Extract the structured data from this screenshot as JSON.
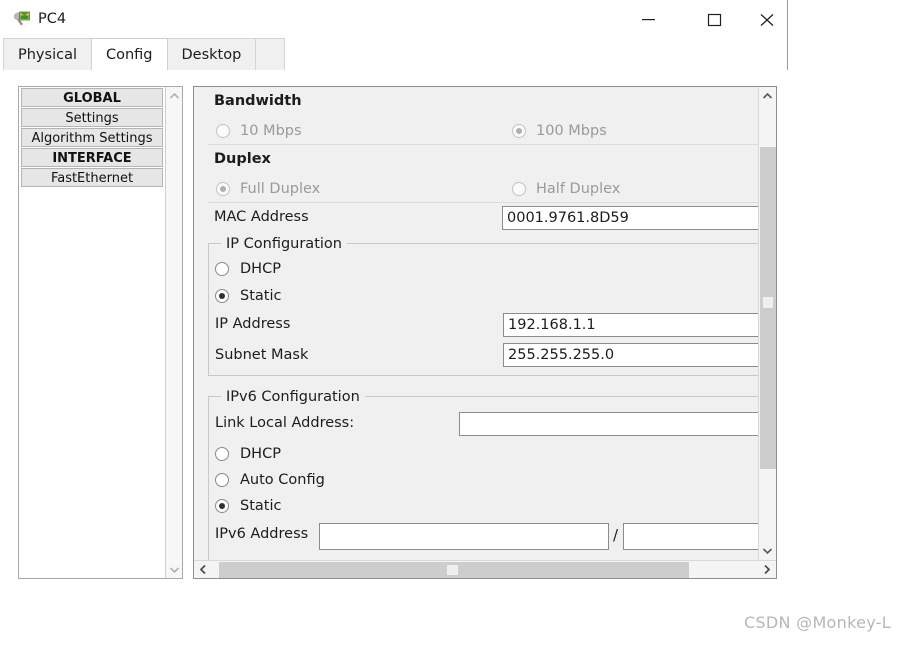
{
  "window": {
    "title": "PC4",
    "icon": "pc-device-icon",
    "controls": {
      "minimize": "minimize-icon",
      "maximize": "maximize-icon",
      "close": "close-icon"
    }
  },
  "tabs": [
    {
      "label": "Physical",
      "active": false
    },
    {
      "label": "Config",
      "active": true
    },
    {
      "label": "Desktop",
      "active": false
    }
  ],
  "sidebar": {
    "items": [
      {
        "label": "GLOBAL",
        "type": "header"
      },
      {
        "label": "Settings",
        "type": "item"
      },
      {
        "label": "Algorithm Settings",
        "type": "item"
      },
      {
        "label": "INTERFACE",
        "type": "header"
      },
      {
        "label": "FastEthernet",
        "type": "item"
      }
    ]
  },
  "config": {
    "bandwidth": {
      "label": "Bandwidth",
      "auto_checked": true,
      "options": [
        {
          "label": "10 Mbps",
          "selected": false,
          "disabled": true
        },
        {
          "label": "100 Mbps",
          "selected": true,
          "disabled": true
        }
      ]
    },
    "duplex": {
      "label": "Duplex",
      "auto_checked": true,
      "options": [
        {
          "label": "Full Duplex",
          "selected": true,
          "disabled": true
        },
        {
          "label": "Half Duplex",
          "selected": false,
          "disabled": true
        }
      ]
    },
    "mac": {
      "label": "MAC Address",
      "value": "0001.9761.8D59"
    },
    "ip_configuration": {
      "title": "IP Configuration",
      "dhcp": {
        "label": "DHCP",
        "selected": false
      },
      "static": {
        "label": "Static",
        "selected": true
      },
      "ip_address": {
        "label": "IP Address",
        "value": "192.168.1.1"
      },
      "subnet_mask": {
        "label": "Subnet Mask",
        "value": "255.255.255.0"
      }
    },
    "ipv6_configuration": {
      "title": "IPv6 Configuration",
      "link_local": {
        "label": "Link Local Address:",
        "value": ""
      },
      "dhcp": {
        "label": "DHCP",
        "selected": false
      },
      "auto_config": {
        "label": "Auto Config",
        "selected": false
      },
      "static": {
        "label": "Static",
        "selected": true
      },
      "ipv6_address": {
        "label": "IPv6 Address",
        "value": "",
        "separator": "/",
        "prefix_value": ""
      }
    }
  },
  "watermark": "CSDN @Monkey-L",
  "colors": {
    "window_bg": "#f0f0f0",
    "panel_bg": "#f0f0f0",
    "field_bg": "#ffffff",
    "text": "#1c1c1c",
    "disabled_text": "#9a9a9a",
    "scroll_thumb": "#cdcdcd"
  }
}
